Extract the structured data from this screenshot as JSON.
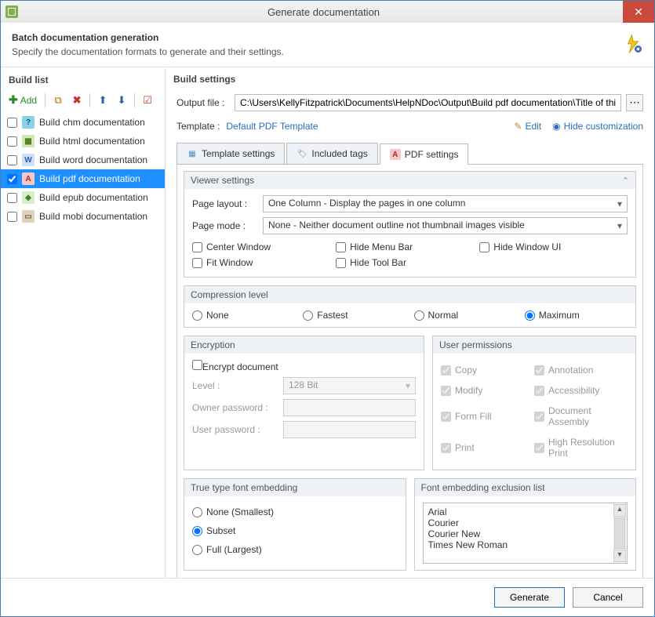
{
  "window": {
    "title": "Generate documentation"
  },
  "header": {
    "title": "Batch documentation generation",
    "subtitle": "Specify the documentation formats to generate and their settings."
  },
  "build_list": {
    "title": "Build list",
    "add_label": "Add",
    "items": [
      {
        "label": "Build chm documentation",
        "checked": false,
        "selected": false,
        "icon": "?"
      },
      {
        "label": "Build html documentation",
        "checked": false,
        "selected": false,
        "icon": "H"
      },
      {
        "label": "Build word documentation",
        "checked": false,
        "selected": false,
        "icon": "W"
      },
      {
        "label": "Build pdf documentation",
        "checked": true,
        "selected": true,
        "icon": "A"
      },
      {
        "label": "Build epub documentation",
        "checked": false,
        "selected": false,
        "icon": "◇"
      },
      {
        "label": "Build mobi documentation",
        "checked": false,
        "selected": false,
        "icon": "M"
      }
    ]
  },
  "build_settings": {
    "title": "Build settings",
    "output_label": "Output file :",
    "output_value": "C:\\Users\\KellyFitzpatrick\\Documents\\HelpNDoc\\Output\\Build pdf documentation\\Title of this help project.pd",
    "template_label": "Template :",
    "template_value": "Default PDF Template",
    "edit_label": "Edit",
    "hide_label": "Hide customization"
  },
  "tabs": {
    "template": "Template settings",
    "included": "Included tags",
    "pdf": "PDF settings"
  },
  "viewer": {
    "group": "Viewer settings",
    "page_layout_label": "Page layout :",
    "page_layout_value": "One Column - Display the pages in one column",
    "page_mode_label": "Page mode :",
    "page_mode_value": "None - Neither document outline not thumbnail images visible",
    "checks": {
      "center": "Center Window",
      "fit": "Fit Window",
      "hide_menu": "Hide Menu Bar",
      "hide_tool": "Hide Tool Bar",
      "hide_window": "Hide Window UI"
    }
  },
  "compression": {
    "group": "Compression level",
    "none": "None",
    "fastest": "Fastest",
    "normal": "Normal",
    "maximum": "Maximum"
  },
  "encryption": {
    "group": "Encryption",
    "encrypt": "Encrypt document",
    "level_label": "Level :",
    "level_value": "128 Bit",
    "owner_label": "Owner password :",
    "user_label": "User password :"
  },
  "permissions": {
    "group": "User permissions",
    "copy": "Copy",
    "annotation": "Annotation",
    "modify": "Modify",
    "accessibility": "Accessibility",
    "form_fill": "Form Fill",
    "doc_assembly": "Document Assembly",
    "print": "Print",
    "hires_print": "High Resolution Print"
  },
  "font_embed": {
    "group": "True type font embedding",
    "none": "None (Smallest)",
    "subset": "Subset",
    "full": "Full (Largest)"
  },
  "exclusion": {
    "group": "Font embedding exclusion list",
    "items": [
      "Arial",
      "Courier",
      "Courier New",
      "Times New Roman"
    ]
  },
  "footer": {
    "generate": "Generate",
    "cancel": "Cancel"
  }
}
